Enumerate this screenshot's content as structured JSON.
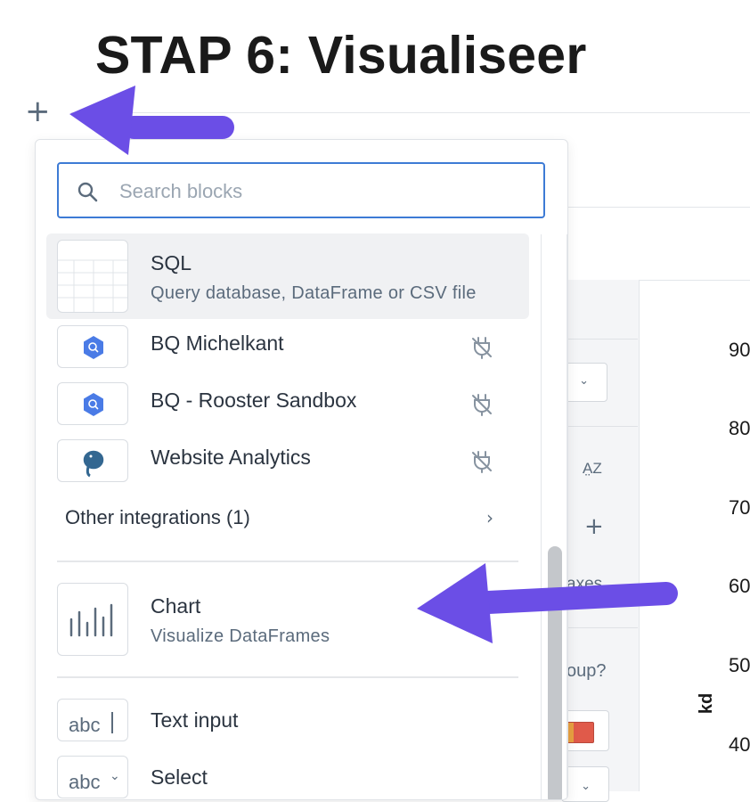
{
  "page": {
    "title": "STAP 6: Visualiseer"
  },
  "search": {
    "placeholder": "Search blocks",
    "value": ""
  },
  "blocks": {
    "sql": {
      "label": "SQL",
      "description": "Query database, DataFrame or CSV file"
    },
    "integrations": [
      {
        "label": "BQ Michelkant",
        "icon": "bigquery-icon"
      },
      {
        "label": "BQ - Rooster Sandbox",
        "icon": "bigquery-icon"
      },
      {
        "label": "Website Analytics",
        "icon": "postgres-elephant-icon"
      }
    ],
    "other_integrations": "Other integrations (1)",
    "chart": {
      "label": "Chart",
      "description": "Visualize DataFrames"
    },
    "text_input": {
      "label": "Text input",
      "thumb": "abc"
    },
    "select": {
      "label": "Select",
      "thumb": "abc"
    }
  },
  "background": {
    "axes_label": "axes",
    "group_label": "oup?",
    "y_ticks": [
      "90",
      "80",
      "70",
      "60",
      "50",
      "40"
    ],
    "y_axis_label": "kd"
  },
  "colors": {
    "accent": "#3d7bd5",
    "arrow": "#6b4ee6",
    "bigquery": "#4a7be6"
  }
}
